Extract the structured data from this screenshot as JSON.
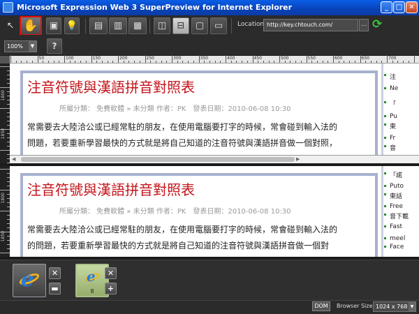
{
  "window": {
    "title": "Microsoft Expression Web 3 SuperPreview for Internet Explorer",
    "min_label": "_",
    "max_label": "□",
    "close_label": "✕"
  },
  "toolbar": {
    "location_label": "Location:",
    "location_value": "http://key.chtouch.com/",
    "location_more": "...",
    "zoom_value": "100%",
    "help_label": "?",
    "highlighted_tool": "hand-icon"
  },
  "ruler": {
    "top_labels": [
      "50",
      "100",
      "150",
      "200",
      "250",
      "300",
      "350",
      "400",
      "450",
      "500",
      "550",
      "600",
      "650",
      "700"
    ],
    "left_top_labels": [
      "1800",
      "1850"
    ],
    "left_bottom_labels": [
      "1800",
      "1850"
    ]
  },
  "preview_top": {
    "title": "注音符號與漢語拼音對照表",
    "meta": "所屬分類： 免費軟體 » 未分類 作者：PK　發表日期：2010-06-08 10:30",
    "body_line1": "常需要去大陸洽公或已經常駐的朋友，在使用電腦要打字的時候，常會碰到輸入法的",
    "body_line2": "問題，若要重新學習最快的方式就是將自己知道的注音符號與漢語拼音做一個對照，",
    "sidebar": [
      "注",
      "Ne",
      "「",
      "Pu",
      "東",
      "Fr",
      "音"
    ]
  },
  "preview_bottom": {
    "title": "注音符號與漢語拼音對照表",
    "meta": "所屬分類： 免費軟體 » 未分類 作者：PK　發表日期：2010-06-08 10:30",
    "body_line1": "常需要去大陸洽公或已經常駐的朋友，在使用電腦要打字的時候，常會碰到輸入法的",
    "body_line2": "的問題，若要重新學習最快的方式就是將自己知道的注音符號與漢語拼音做一個對",
    "sidebar": [
      "「諾",
      "Puto",
      "東話",
      "Free",
      "音下載",
      "Fast",
      "meel",
      "Face"
    ]
  },
  "tray": {
    "tile_b_version": "8"
  },
  "status": {
    "dom_label": "DOM",
    "browser_size_label": "Browser Size:",
    "browser_size_value": "1024 x 768"
  },
  "colors": {
    "title_red": "#c4141b",
    "frame_blue": "#a7b1cf",
    "highlight_red": "#e01010",
    "refresh_green": "#3ec63e",
    "ie_blue": "#2a7ad8",
    "ie_ring": "#f2b319"
  }
}
